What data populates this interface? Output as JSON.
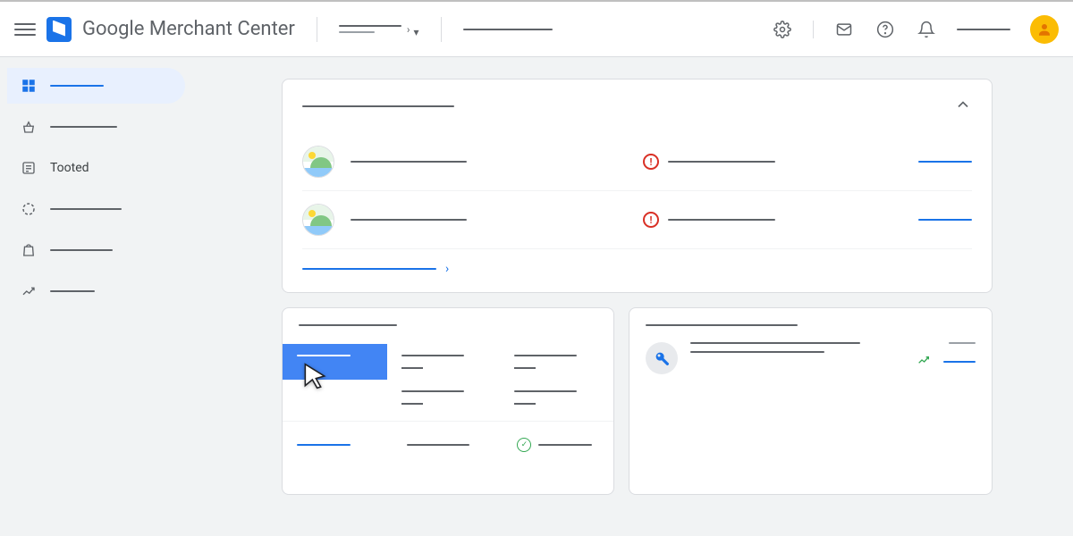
{
  "header": {
    "app_title": "Google Merchant Center",
    "icons": {
      "settings": "gear",
      "mail": "envelope",
      "help": "question",
      "notifications": "bell"
    }
  },
  "sidebar": {
    "items": [
      {
        "id": "overview",
        "label": "",
        "icon": "dashboard",
        "active": true
      },
      {
        "id": "shopping",
        "label": "",
        "icon": "basket"
      },
      {
        "id": "products",
        "label": "Tooted",
        "icon": "list"
      },
      {
        "id": "performance",
        "label": "",
        "icon": "circle-dashed"
      },
      {
        "id": "marketing",
        "label": "",
        "icon": "bag"
      },
      {
        "id": "growth",
        "label": "",
        "icon": "trend"
      }
    ]
  },
  "overview_card": {
    "title": "",
    "programs": [
      {
        "name": "",
        "status_text": "",
        "status": "error",
        "action": ""
      },
      {
        "name": "",
        "status_text": "",
        "status": "error",
        "action": ""
      }
    ],
    "view_all": ""
  },
  "stats_card": {
    "title": "",
    "cells": [
      {
        "label": "",
        "value": "",
        "active": true
      },
      {
        "label": "",
        "value": ""
      },
      {
        "label": "",
        "value": ""
      }
    ],
    "row2_cells": [
      {
        "label": "",
        "value": ""
      },
      {
        "label": "",
        "value": ""
      },
      {
        "label": "",
        "value": ""
      }
    ],
    "footer_link": "",
    "footer_mid": "",
    "footer_check": ""
  },
  "recommendations_card": {
    "title": "",
    "rec": {
      "line1": "",
      "line2": "",
      "meta": "",
      "action": ""
    }
  },
  "colors": {
    "primary": "#1a73e8",
    "error": "#d93025",
    "success": "#34a853",
    "accent": "#fbbc04"
  }
}
